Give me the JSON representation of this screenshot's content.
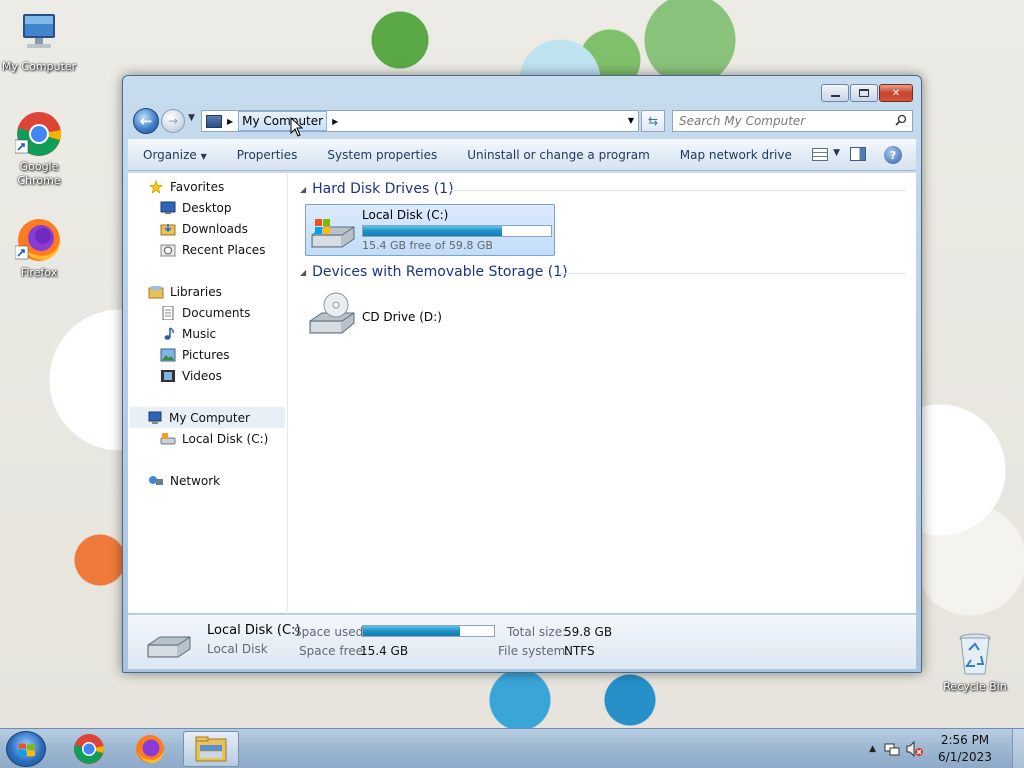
{
  "desktop": {
    "icons": [
      {
        "label": "My Computer"
      },
      {
        "label": "Google Chrome"
      },
      {
        "label": "Firefox"
      },
      {
        "label": "Recycle Bin"
      }
    ]
  },
  "window": {
    "address": {
      "crumb": "My Computer"
    },
    "search": {
      "placeholder": "Search My Computer"
    },
    "commands": [
      "Organize",
      "Properties",
      "System properties",
      "Uninstall or change a program",
      "Map network drive"
    ],
    "more": "»",
    "nav": {
      "favorites": "Favorites",
      "desktop": "Desktop",
      "downloads": "Downloads",
      "recent": "Recent Places",
      "libraries": "Libraries",
      "documents": "Documents",
      "music": "Music",
      "pictures": "Pictures",
      "videos": "Videos",
      "computer": "My Computer",
      "local_disk": "Local Disk (C:)",
      "network": "Network"
    },
    "groups": {
      "hdd": "Hard Disk Drives (1)",
      "removable": "Devices with Removable Storage (1)"
    },
    "drive_c": {
      "name": "Local Disk (C:)",
      "free_text": "15.4 GB free of 59.8 GB",
      "used_fraction": 0.74
    },
    "drive_d": {
      "name": "CD Drive (D:)"
    },
    "details": {
      "title": "Local Disk (C:)",
      "subtitle": "Local Disk",
      "space_used_label": "Space used:",
      "space_free_label": "Space free:",
      "space_free_value": "15.4 GB",
      "total_size_label": "Total size:",
      "total_size_value": "59.8 GB",
      "file_system_label": "File system:",
      "file_system_value": "NTFS",
      "used_fraction": 0.74
    }
  },
  "taskbar": {
    "clock_time": "2:56 PM",
    "clock_date": "6/1/2023"
  },
  "colors": {
    "group_header": "#1e3287",
    "drive_bar": "#1e8fc4",
    "selection": "#c1dcf9"
  }
}
